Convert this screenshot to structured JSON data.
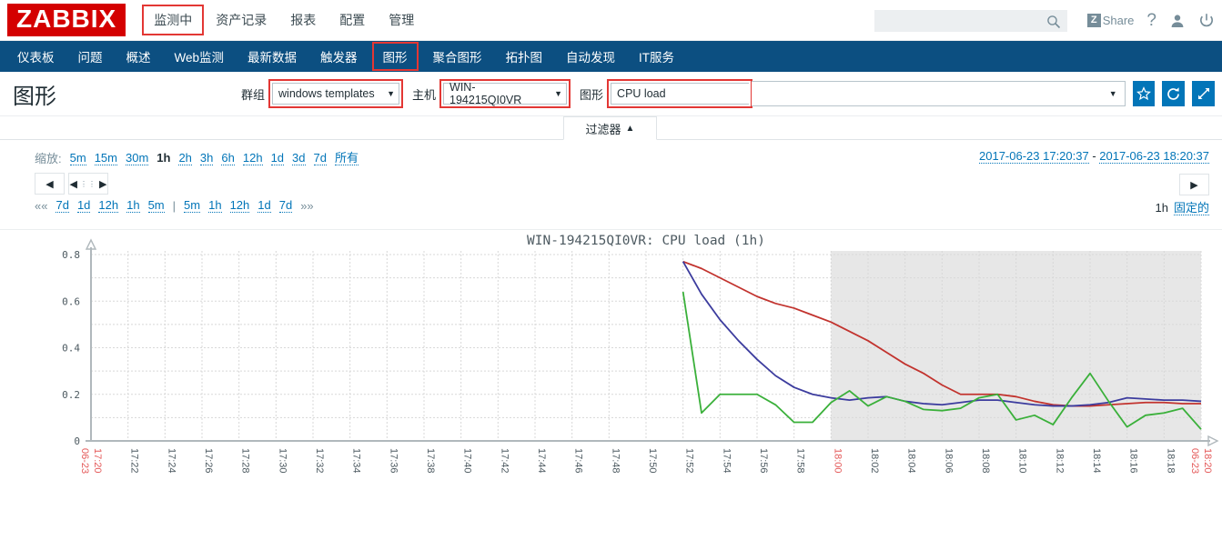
{
  "header": {
    "logo": "ZABBIX",
    "nav": [
      {
        "label": "监测中",
        "highlighted": true
      },
      {
        "label": "资产记录",
        "highlighted": false
      },
      {
        "label": "报表",
        "highlighted": false
      },
      {
        "label": "配置",
        "highlighted": false
      },
      {
        "label": "管理",
        "highlighted": false
      }
    ],
    "search_placeholder": "",
    "search_value": "",
    "share_label": "Share",
    "share_mark": "Z",
    "help_label": "?",
    "icons": [
      "search-icon",
      "share-icon",
      "help-icon",
      "user-icon",
      "power-icon"
    ]
  },
  "subnav": [
    {
      "label": "仪表板",
      "highlighted": false
    },
    {
      "label": "问题",
      "highlighted": false
    },
    {
      "label": "概述",
      "highlighted": false
    },
    {
      "label": "Web监测",
      "highlighted": false
    },
    {
      "label": "最新数据",
      "highlighted": false
    },
    {
      "label": "触发器",
      "highlighted": false
    },
    {
      "label": "图形",
      "highlighted": true
    },
    {
      "label": "聚合图形",
      "highlighted": false
    },
    {
      "label": "拓扑图",
      "highlighted": false
    },
    {
      "label": "自动发现",
      "highlighted": false
    },
    {
      "label": "IT服务",
      "highlighted": false
    }
  ],
  "page": {
    "title": "图形",
    "group_label": "群组",
    "group_value": "windows templates",
    "host_label": "主机",
    "host_value": "WIN-194215QI0VR",
    "graph_label": "图形",
    "graph_value": "CPU load",
    "caret": "▼",
    "buttons": [
      {
        "name": "favorite-button",
        "glyph": "☆"
      },
      {
        "name": "refresh-button",
        "glyph": "⟳"
      },
      {
        "name": "fullscreen-button",
        "glyph": "⤢"
      }
    ]
  },
  "filter_tab": {
    "label": "过滤器",
    "arrow": "▲"
  },
  "timefilter": {
    "zoom_label": "缩放:",
    "zoom_options": [
      {
        "label": "5m",
        "current": false
      },
      {
        "label": "15m",
        "current": false
      },
      {
        "label": "30m",
        "current": false
      },
      {
        "label": "1h",
        "current": true
      },
      {
        "label": "2h",
        "current": false
      },
      {
        "label": "3h",
        "current": false
      },
      {
        "label": "6h",
        "current": false
      },
      {
        "label": "12h",
        "current": false
      },
      {
        "label": "1d",
        "current": false
      },
      {
        "label": "3d",
        "current": false
      },
      {
        "label": "7d",
        "current": false
      },
      {
        "label": "所有",
        "current": false
      }
    ],
    "range_from": "2017-06-23 17:20:37",
    "range_sep": " - ",
    "range_to": "2017-06-23 18:20:37",
    "nav_left_glyph": "◀",
    "nav_scroll_left_glyph": "◀",
    "nav_scroll_dots": "⋮⋮",
    "nav_scroll_right_glyph": "▶",
    "nav_right_glyph": "▶",
    "jump_start": "««",
    "jump_back": [
      "7d",
      "1d",
      "12h",
      "1h",
      "5m"
    ],
    "jump_divider": "|",
    "jump_fwd": [
      "5m",
      "1h",
      "12h",
      "1d",
      "7d"
    ],
    "jump_end": "»»",
    "period_label": "1h",
    "fixed_label": "固定的"
  },
  "chart_data": {
    "type": "line",
    "title": "WIN-194215QI0VR: CPU load (1h)",
    "xlabel": "",
    "ylabel": "",
    "ylim": [
      0,
      0.8
    ],
    "yticks": [
      0,
      0.2,
      0.4,
      0.6,
      0.8
    ],
    "ytick_labels": [
      "0",
      "0.2",
      "0.4",
      "0.6",
      "0.8"
    ],
    "grid": true,
    "legend": "none",
    "x_start_label": "06-23 17:20",
    "x_end_label": "06-23 18:20",
    "x_highlight_label": "18:00",
    "xtick_labels": [
      "17:20",
      "17:22",
      "17:24",
      "17:26",
      "17:28",
      "17:30",
      "17:32",
      "17:34",
      "17:36",
      "17:38",
      "17:40",
      "17:42",
      "17:44",
      "17:46",
      "17:48",
      "17:50",
      "17:52",
      "17:54",
      "17:56",
      "17:58",
      "18:00",
      "18:02",
      "18:04",
      "18:06",
      "18:08",
      "18:10",
      "18:12",
      "18:14",
      "18:16",
      "18:18",
      "18:20"
    ],
    "shaded_region": {
      "from": "18:00",
      "to": "18:20",
      "color": "#e3e3e3"
    },
    "series": [
      {
        "name": "red-series",
        "color": "#c2332e",
        "x": [
          "17:52",
          "17:53",
          "17:54",
          "17:55",
          "17:56",
          "17:57",
          "17:58",
          "17:59",
          "18:00",
          "18:01",
          "18:02",
          "18:03",
          "18:04",
          "18:05",
          "18:06",
          "18:07",
          "18:08",
          "18:09",
          "18:10",
          "18:11",
          "18:12",
          "18:13",
          "18:14",
          "18:15",
          "18:16",
          "18:17",
          "18:18",
          "18:19",
          "18:20"
        ],
        "values": [
          0.77,
          0.74,
          0.7,
          0.66,
          0.62,
          0.59,
          0.57,
          0.54,
          0.51,
          0.47,
          0.43,
          0.38,
          0.33,
          0.29,
          0.24,
          0.2,
          0.2,
          0.2,
          0.19,
          0.17,
          0.155,
          0.15,
          0.15,
          0.155,
          0.16,
          0.165,
          0.165,
          0.16,
          0.16
        ]
      },
      {
        "name": "blue-series",
        "color": "#3c3c9e",
        "x": [
          "17:52",
          "17:53",
          "17:54",
          "17:55",
          "17:56",
          "17:57",
          "17:58",
          "17:59",
          "18:00",
          "18:01",
          "18:02",
          "18:03",
          "18:04",
          "18:05",
          "18:06",
          "18:07",
          "18:08",
          "18:09",
          "18:10",
          "18:11",
          "18:12",
          "18:13",
          "18:14",
          "18:15",
          "18:16",
          "18:17",
          "18:18",
          "18:19",
          "18:20"
        ],
        "values": [
          0.77,
          0.63,
          0.52,
          0.43,
          0.35,
          0.28,
          0.23,
          0.2,
          0.185,
          0.175,
          0.185,
          0.19,
          0.17,
          0.16,
          0.155,
          0.165,
          0.175,
          0.175,
          0.165,
          0.155,
          0.15,
          0.15,
          0.155,
          0.165,
          0.185,
          0.18,
          0.175,
          0.175,
          0.17
        ]
      },
      {
        "name": "green-series",
        "color": "#3ab03a",
        "x": [
          "17:52",
          "17:53",
          "17:54",
          "17:55",
          "17:56",
          "17:57",
          "17:58",
          "17:59",
          "18:00",
          "18:01",
          "18:02",
          "18:03",
          "18:04",
          "18:05",
          "18:06",
          "18:07",
          "18:08",
          "18:09",
          "18:10",
          "18:11",
          "18:12",
          "18:13",
          "18:14",
          "18:15",
          "18:16",
          "18:17",
          "18:18",
          "18:19",
          "18:20"
        ],
        "values": [
          0.64,
          0.12,
          0.2,
          0.2,
          0.2,
          0.155,
          0.08,
          0.08,
          0.165,
          0.215,
          0.15,
          0.19,
          0.17,
          0.135,
          0.13,
          0.14,
          0.185,
          0.2,
          0.09,
          0.11,
          0.07,
          0.185,
          0.29,
          0.17,
          0.06,
          0.11,
          0.12,
          0.14,
          0.05
        ]
      }
    ]
  }
}
